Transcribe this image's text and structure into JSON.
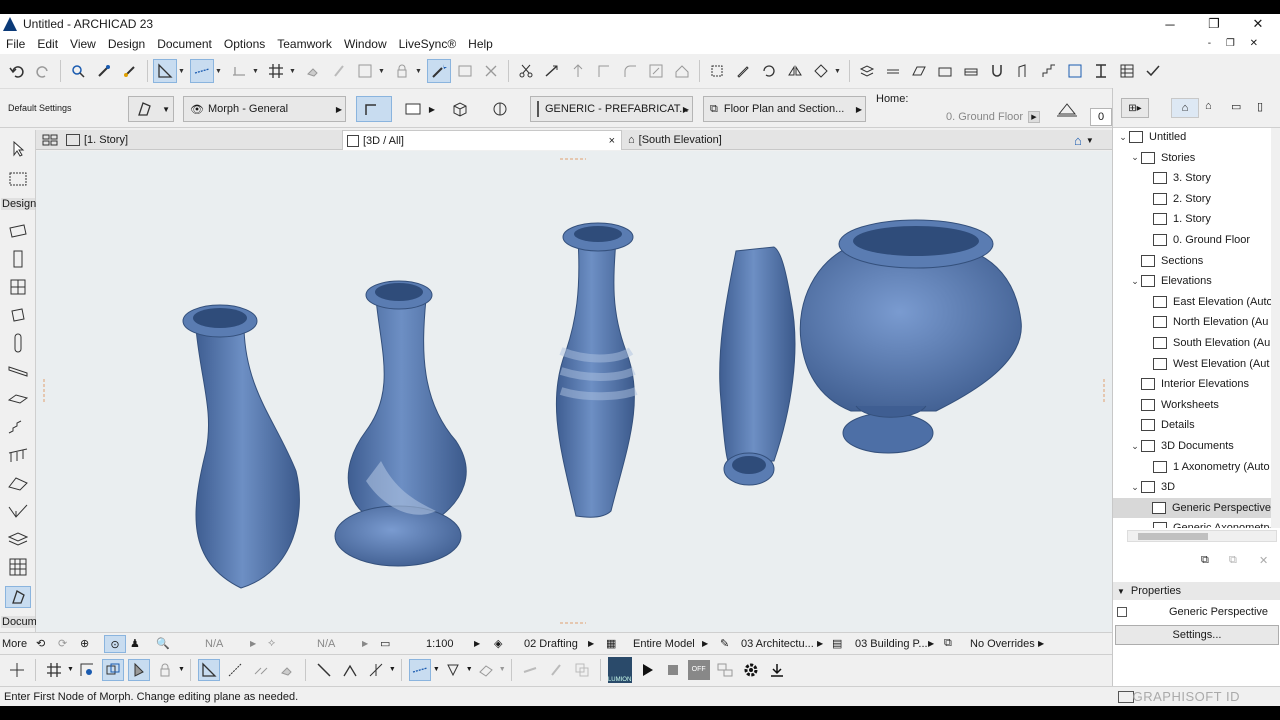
{
  "window": {
    "title": "Untitled - ARCHICAD 23",
    "minimize": "─",
    "maximize": "❐",
    "close": "✕"
  },
  "menu": [
    "File",
    "Edit",
    "View",
    "Design",
    "Document",
    "Options",
    "Teamwork",
    "Window",
    "LiveSync®",
    "Help"
  ],
  "menu_right": "- ❐ ✕",
  "infobox": {
    "default_settings": "Default Settings",
    "layer": "Morph - General",
    "material": "GENERIC - PREFABRICAT...",
    "view_filter": "Floor Plan and Section...",
    "home_label": "Home:",
    "home_story": "0. Ground Floor",
    "story_value": "0"
  },
  "tabs": [
    {
      "label": "[1. Story]"
    },
    {
      "label": "[3D / All]",
      "close": "×"
    },
    {
      "label": "[South Elevation]"
    }
  ],
  "toolbox": {
    "design": "Design",
    "document": "Docum",
    "more": "More"
  },
  "navigator": {
    "items": [
      {
        "label": "Untitled",
        "expander": "⌄"
      },
      {
        "label": "Stories",
        "expander": "⌄"
      },
      {
        "label": "3. Story"
      },
      {
        "label": "2. Story"
      },
      {
        "label": "1. Story"
      },
      {
        "label": "0. Ground Floor"
      },
      {
        "label": "Sections"
      },
      {
        "label": "Elevations",
        "expander": "⌄"
      },
      {
        "label": "East Elevation (Auto"
      },
      {
        "label": "North Elevation (Au"
      },
      {
        "label": "South Elevation (Au"
      },
      {
        "label": "West Elevation (Aut"
      },
      {
        "label": "Interior Elevations"
      },
      {
        "label": "Worksheets"
      },
      {
        "label": "Details"
      },
      {
        "label": "3D Documents",
        "expander": "⌄"
      },
      {
        "label": "1 Axonometry (Auto"
      },
      {
        "label": "3D",
        "expander": "⌄"
      },
      {
        "label": "Generic Perspective"
      },
      {
        "label": "Generic Axonometry"
      }
    ]
  },
  "properties": {
    "header": "Properties",
    "name": "Generic Perspective",
    "settings": "Settings..."
  },
  "quick_options": {
    "zoom": "N/A",
    "angle": "N/A",
    "scale": "1:100",
    "layer_combo": "02 Drafting",
    "model_view": "Entire Model",
    "pen_set": "03 Architectu...",
    "dimension": "03 Building P...",
    "overrides": "No Overrides"
  },
  "toolbar2": {
    "lumion": "LUMION",
    "off": "OFF"
  },
  "status": {
    "message": "Enter First Node of Morph. Change editing plane as needed.",
    "brand": "GRAPHISOFT ID"
  },
  "colors": {
    "vase": "#5b7db0",
    "vase_dark": "#3f5e92",
    "accent_select": "#c8dcf0",
    "viewport_bg": "#eaeef0"
  }
}
